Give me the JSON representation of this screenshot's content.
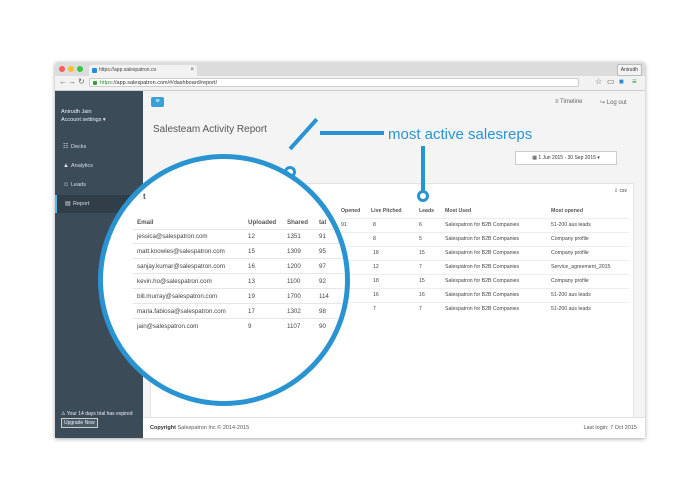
{
  "browser": {
    "tab_title": "https://app.salespatron.co",
    "profile": "Anirudh",
    "url_https": "https",
    "url_rest": "://app.salespatron.com/#/dashboard/report/"
  },
  "sidebar": {
    "user_name": "Anirudh Jain",
    "account_settings": "Account settings ▾",
    "items": [
      {
        "label": "Decks",
        "icon": "☷"
      },
      {
        "label": "Analytics",
        "icon": "▲"
      },
      {
        "label": "Leads",
        "icon": "☺"
      },
      {
        "label": "Report",
        "icon": "▤"
      }
    ],
    "trial_text": "⚠ Your 14 days trial has expired",
    "upgrade_label": "Upgrade Now"
  },
  "header": {
    "menu_icon": "≡",
    "timeline_label": "≡  Timeline",
    "logout_label": "↪  Log out"
  },
  "page": {
    "title": "Salesteam Activity Report",
    "date_range": "▦ 1 Jun 2015 - 30 Sep 2015 ▾",
    "panel_title_fragment": "t",
    "csv_label": "⇩ csv"
  },
  "table": {
    "columns": [
      "Email",
      "Uploaded",
      "Shared",
      "Opened",
      "Live Pitched",
      "Leads",
      "Most Used",
      "Most opened"
    ],
    "partial_header": "tal",
    "rows": [
      {
        "email": "jessica@salespatron.com",
        "uploaded": "12",
        "shared": "1351",
        "total": "91",
        "opened": "91",
        "live": "8",
        "leads": "6",
        "most_used": "Salespatron for B2B Companies",
        "most_opened": "51-200 aus leads"
      },
      {
        "email": "matt.knowles@salespatron.com",
        "uploaded": "15",
        "shared": "1309",
        "total": "95",
        "opened": "",
        "live": "8",
        "leads": "5",
        "most_used": "Salespatron for B2B Companies",
        "most_opened": "Company profile"
      },
      {
        "email": "sanjay.kumar@salespatron.com",
        "uploaded": "16",
        "shared": "1200",
        "total": "97",
        "opened": "",
        "live": "18",
        "leads": "15",
        "most_used": "Salespatron for B2B Companies",
        "most_opened": "Company profile"
      },
      {
        "email": "kevin.ho@salespatron.com",
        "uploaded": "13",
        "shared": "1100",
        "total": "92",
        "opened": "",
        "live": "12",
        "leads": "7",
        "most_used": "Salespatron for B2B Companies",
        "most_opened": "Service_agreement_2015"
      },
      {
        "email": "bill.murray@salespatron.com",
        "uploaded": "19",
        "shared": "1700",
        "total": "114",
        "opened": "",
        "live": "18",
        "leads": "15",
        "most_used": "Salespatron for B2B Companies",
        "most_opened": "Company profile"
      },
      {
        "email": "maria.fabiosa@salespatron.com",
        "uploaded": "17",
        "shared": "1302",
        "total": "98",
        "opened": "",
        "live": "16",
        "leads": "16",
        "most_used": "Salespatron for B2B Companies",
        "most_opened": "51-200 aus leads"
      },
      {
        "email": "jain@salespatron.com",
        "uploaded": "9",
        "shared": "1107",
        "total": "90",
        "opened": "",
        "live": "7",
        "leads": "7",
        "most_used": "Salespatron for B2B Companies",
        "most_opened": "51-200 aus leads"
      }
    ]
  },
  "footer": {
    "copyright_bold": "Copyright",
    "copyright_rest": " Salespatron Inc © 2014-2015",
    "last_login": "Last login: 7 Oct 2015"
  },
  "callout": {
    "text": "most active salesreps"
  },
  "colors": {
    "accent": "#2a94d2",
    "sidebar": "#3b4c58"
  }
}
